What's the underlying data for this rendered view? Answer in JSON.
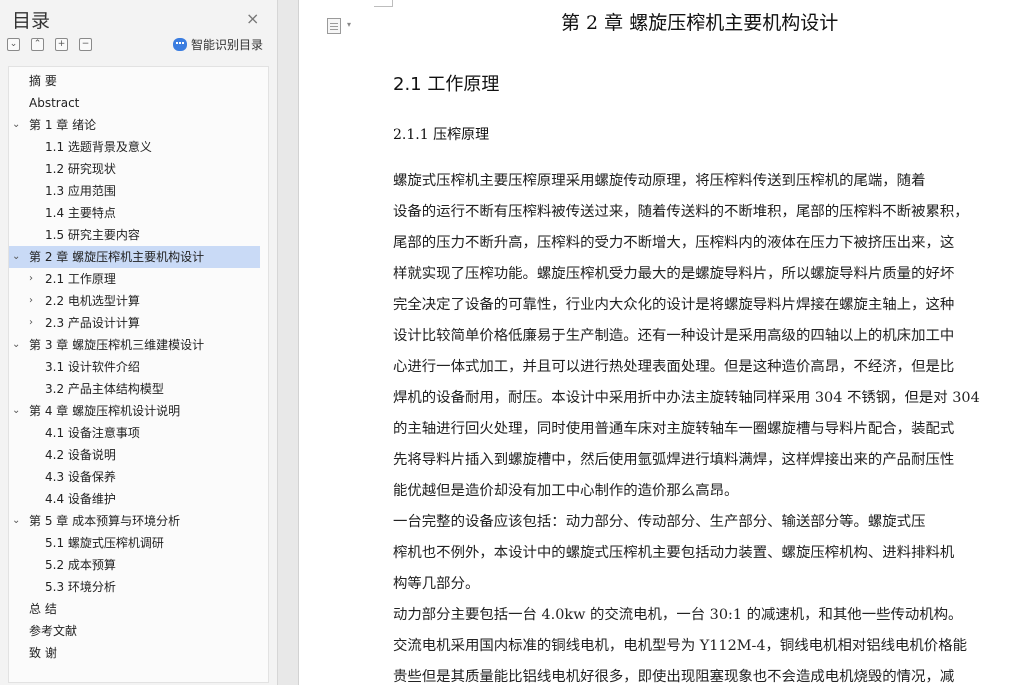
{
  "toc": {
    "title": "目录",
    "close_icon": "×",
    "smart_label": "智能识别目录",
    "tools": [
      "⌄",
      "⌃",
      "+",
      "−"
    ],
    "items": [
      {
        "label": "摘    要",
        "level": 0,
        "arrow": ""
      },
      {
        "label": "Abstract",
        "level": 0,
        "arrow": ""
      },
      {
        "label": "第 1 章  绪论",
        "level": 0,
        "arrow": "⌄"
      },
      {
        "label": "1.1 选题背景及意义",
        "level": 2,
        "arrow": ""
      },
      {
        "label": "1.2 研究现状",
        "level": 2,
        "arrow": ""
      },
      {
        "label": "1.3 应用范围",
        "level": 2,
        "arrow": ""
      },
      {
        "label": "1.4 主要特点",
        "level": 2,
        "arrow": ""
      },
      {
        "label": "1.5  研究主要内容",
        "level": 2,
        "arrow": ""
      },
      {
        "label": "第 2 章  螺旋压榨机主要机构设计",
        "level": 0,
        "arrow": "⌄",
        "active": true
      },
      {
        "label": "2.1 工作原理",
        "level": 1,
        "arrow": "›"
      },
      {
        "label": "2.2 电机选型计算",
        "level": 1,
        "arrow": "›"
      },
      {
        "label": "2.3  产品设计计算",
        "level": 1,
        "arrow": "›"
      },
      {
        "label": "第 3 章  螺旋压榨机三维建模设计",
        "level": 0,
        "arrow": "⌄"
      },
      {
        "label": "3.1 设计软件介绍",
        "level": 2,
        "arrow": ""
      },
      {
        "label": "3.2 产品主体结构模型",
        "level": 2,
        "arrow": ""
      },
      {
        "label": "第 4 章  螺旋压榨机设计说明",
        "level": 0,
        "arrow": "⌄"
      },
      {
        "label": "4.1  设备注意事项",
        "level": 2,
        "arrow": ""
      },
      {
        "label": "4.2  设备说明",
        "level": 2,
        "arrow": ""
      },
      {
        "label": "4.3  设备保养",
        "level": 2,
        "arrow": ""
      },
      {
        "label": "4.4 设备维护",
        "level": 2,
        "arrow": ""
      },
      {
        "label": "第 5 章  成本预算与环境分析",
        "level": 0,
        "arrow": "⌄"
      },
      {
        "label": "5.1  螺旋式压榨机调研",
        "level": 2,
        "arrow": ""
      },
      {
        "label": "5.2  成本预算",
        "level": 2,
        "arrow": ""
      },
      {
        "label": "5.3  环境分析",
        "level": 2,
        "arrow": ""
      },
      {
        "label": "总    结",
        "level": 0,
        "arrow": ""
      },
      {
        "label": "参考文献",
        "level": 0,
        "arrow": ""
      },
      {
        "label": "致    谢",
        "level": 0,
        "arrow": ""
      }
    ]
  },
  "document": {
    "chapter_heading": "第 2 章  螺旋压榨机主要机构设计",
    "section_heading": "2.1 工作原理",
    "subsection_heading": "2.1.1 压榨原理",
    "lines": [
      "        螺旋式压榨机主要压榨原理采用螺旋传动原理，将压榨料传送到压榨机的尾端，随着",
      "设备的运行不断有压榨料被传送过来，随着传送料的不断堆积，尾部的压榨料不断被累积，",
      "尾部的压力不断升高，压榨料的受力不断增大，压榨料内的液体在压力下被挤压出来，这",
      "样就实现了压榨功能。螺旋压榨机受力最大的是螺旋导料片，所以螺旋导料片质量的好坏",
      "完全决定了设备的可靠性，行业内大众化的设计是将螺旋导料片焊接在螺旋主轴上，这种",
      "设计比较简单价格低廉易于生产制造。还有一种设计是采用高级的四轴以上的机床加工中",
      "心进行一体式加工，并且可以进行热处理表面处理。但是这种造价高昂，不经济，但是比",
      "焊机的设备耐用，耐压。本设计中采用折中办法主旋转轴同样采用 304 不锈钢，但是对 304",
      "的主轴进行回火处理，同时使用普通车床对主旋转轴车一圈螺旋槽与导料片配合，装配式",
      "先将导料片插入到螺旋槽中，然后使用氩弧焊进行填料满焊，这样焊接出来的产品耐压性",
      "能优越但是造价却没有加工中心制作的造价那么高昂。",
      "        一台完整的设备应该包括：动力部分、传动部分、生产部分、输送部分等。螺旋式压",
      "榨机也不例外，本设计中的螺旋式压榨机主要包括动力装置、螺旋压榨机构、进料排料机",
      "构等几部分。",
      "        动力部分主要包括一台 4.0kw 的交流电机，一台 30:1 的减速机，和其他一些传动机构。",
      "交流电机采用国内标准的铜线电机，电机型号为 Y112M-4，铜线电机相对铝线电机价格能",
      "贵些但是其质量能比铝线电机好很多，即使出现阻塞现象也不会造成电机烧毁的情况，减"
    ]
  }
}
